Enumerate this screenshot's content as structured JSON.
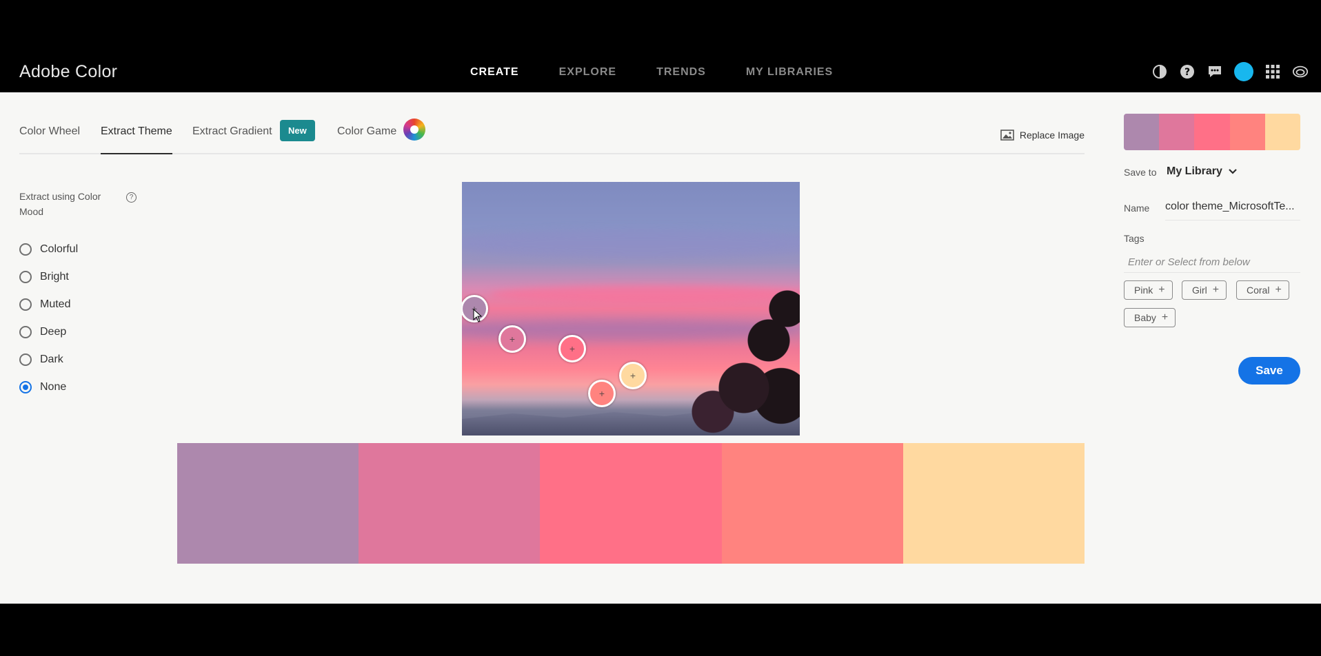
{
  "app": {
    "title": "Adobe Color"
  },
  "nav": [
    {
      "label": "CREATE",
      "active": true
    },
    {
      "label": "EXPLORE",
      "active": false
    },
    {
      "label": "TRENDS",
      "active": false
    },
    {
      "label": "MY LIBRARIES",
      "active": false
    }
  ],
  "tabs": {
    "color_wheel": "Color Wheel",
    "extract_theme": "Extract Theme",
    "extract_gradient": "Extract Gradient",
    "new_badge": "New",
    "color_game": "Color Game",
    "replace_image": "Replace Image"
  },
  "mood": {
    "title": "Extract using Color Mood",
    "help": "?",
    "options": [
      "Colorful",
      "Bright",
      "Muted",
      "Deep",
      "Dark",
      "None"
    ],
    "selected": "None"
  },
  "theme_colors": [
    "#AD88AD",
    "#DF779C",
    "#FF7087",
    "#FF837F",
    "#FFD9A0"
  ],
  "right_panel": {
    "save_to_label": "Save to",
    "save_to_value": "My Library",
    "name_label": "Name",
    "name_value": "color theme_MicrosoftTe...",
    "tags_label": "Tags",
    "tags_placeholder": "Enter or Select from below",
    "tag_suggestions": [
      "Pink",
      "Girl",
      "Coral",
      "Baby"
    ],
    "save_button": "Save"
  },
  "icons": [
    "contrast-icon",
    "help-icon",
    "feedback-icon",
    "avatar",
    "apps-grid-icon",
    "creative-cloud-icon"
  ]
}
